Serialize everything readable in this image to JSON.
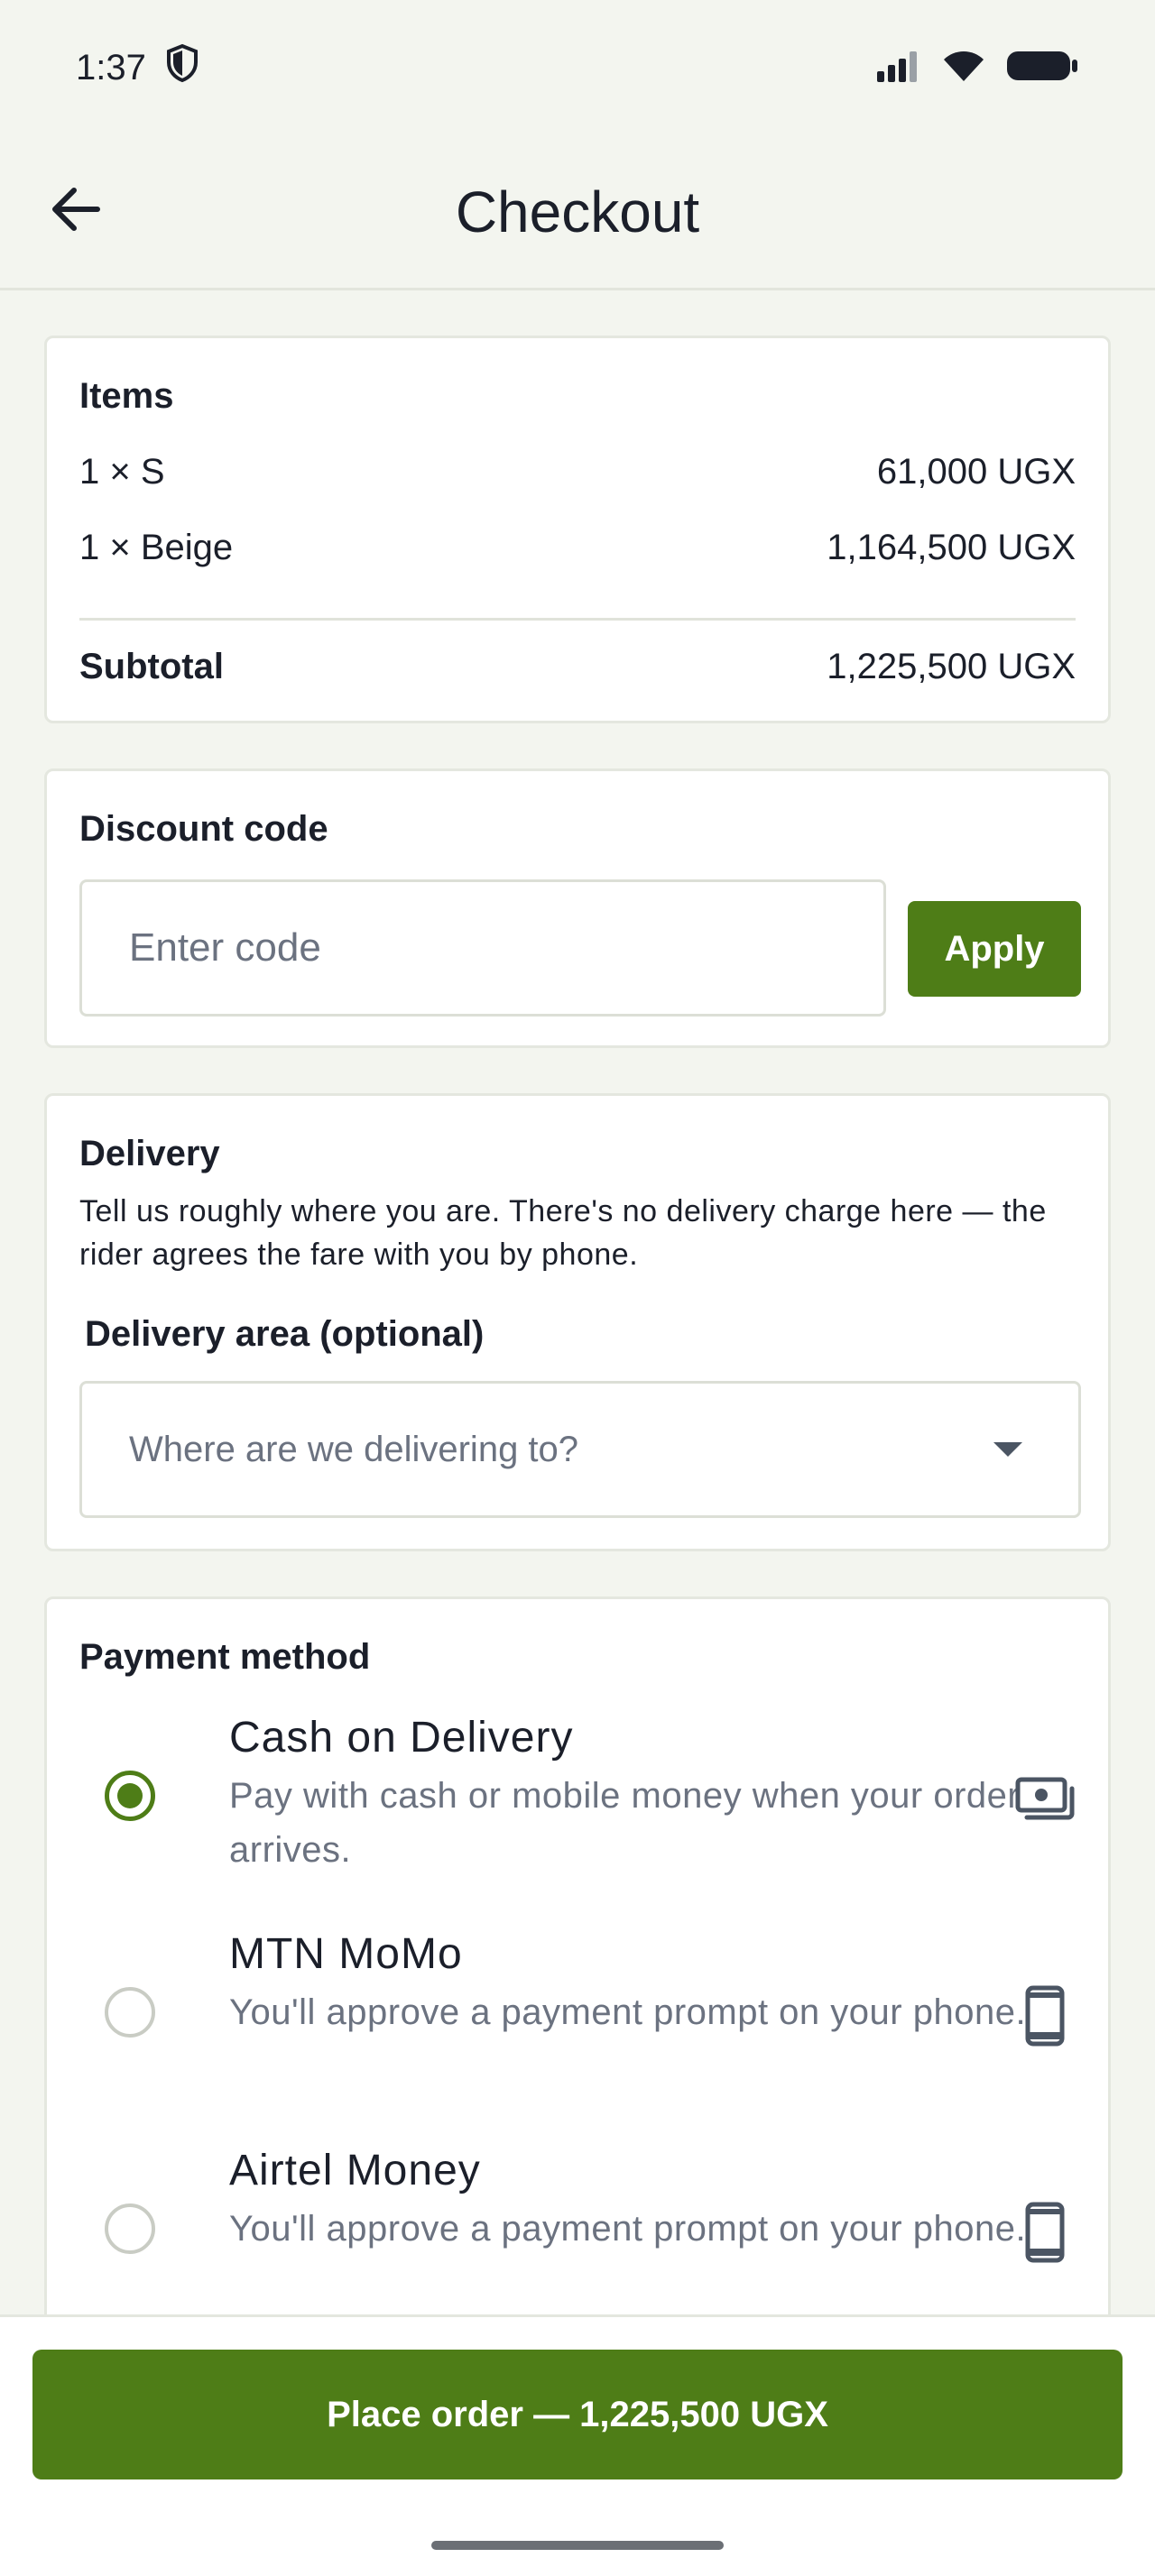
{
  "status_bar": {
    "time": "1:37",
    "icons": [
      "shield-icon",
      "signal-icon",
      "wifi-icon",
      "battery-icon"
    ]
  },
  "app_bar": {
    "title": "Checkout",
    "back_icon": "arrow-left-icon"
  },
  "items": {
    "title": "Items",
    "lines": [
      {
        "label": "1 × S",
        "amount": "61,000 UGX"
      },
      {
        "label": "1 × Beige",
        "amount": "1,164,500 UGX"
      }
    ],
    "subtotal_label": "Subtotal",
    "subtotal_amount": "1,225,500 UGX"
  },
  "discount": {
    "title": "Discount code",
    "placeholder": "Enter code",
    "value": "",
    "apply_label": "Apply"
  },
  "delivery": {
    "title": "Delivery",
    "description": "Tell us roughly where you are. There's no delivery charge here — the rider agrees the fare with you by phone.",
    "area_label": "Delivery area (optional)",
    "area_placeholder": "Where are we delivering to?"
  },
  "payment": {
    "title": "Payment method",
    "options": [
      {
        "title": "Cash on Delivery",
        "description": "Pay with cash or mobile money when your order arrives.",
        "icon": "cash-icon",
        "selected": true
      },
      {
        "title": "MTN MoMo",
        "description": "You'll approve a payment prompt on your phone.",
        "icon": "phone-icon",
        "selected": false
      },
      {
        "title": "Airtel Money",
        "description": "You'll approve a payment prompt on your phone.",
        "icon": "phone-icon",
        "selected": false
      }
    ]
  },
  "place_order": {
    "label": "Place order — 1,225,500 UGX"
  },
  "colors": {
    "accent": "#4e7d17",
    "background": "#f3f5ef",
    "muted_text": "#6b7280"
  }
}
